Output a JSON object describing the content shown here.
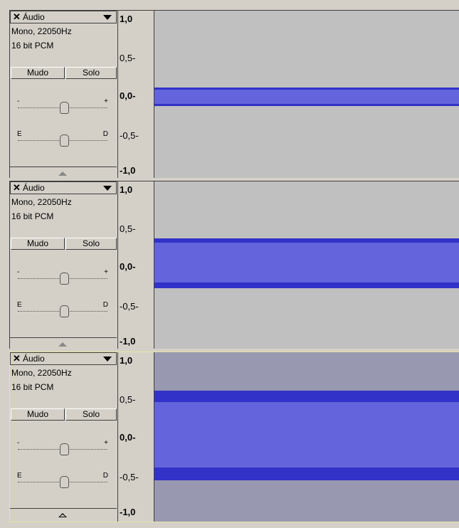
{
  "tracks": [
    {
      "name": "Áudio",
      "info1": "Mono, 22050Hz",
      "info2": "16 bit PCM",
      "mute": "Mudo",
      "solo": "Solo",
      "gain_minus": "-",
      "gain_plus": "+",
      "pan_left": "E",
      "pan_right": "D",
      "ruler": [
        "1,0",
        "0,5-",
        "0,0-",
        "-0,5-",
        "-1,0"
      ],
      "selected": false
    },
    {
      "name": "Áudio",
      "info1": "Mono, 22050Hz",
      "info2": "16 bit PCM",
      "mute": "Mudo",
      "solo": "Solo",
      "gain_minus": "-",
      "gain_plus": "+",
      "pan_left": "E",
      "pan_right": "D",
      "ruler": [
        "1,0",
        "0,5-",
        "0,0-",
        "-0,5-",
        "-1,0"
      ],
      "selected": false
    },
    {
      "name": "Áudio",
      "info1": "Mono, 22050Hz",
      "info2": "16 bit PCM",
      "mute": "Mudo",
      "solo": "Solo",
      "gain_minus": "-",
      "gain_plus": "+",
      "pan_left": "E",
      "pan_right": "D",
      "ruler": [
        "1,0",
        "0,5-",
        "0,0-",
        "-0,5-",
        "-1,0"
      ],
      "selected": true
    }
  ],
  "colors": {
    "waveform": "#6464dc",
    "waveform_edge": "#3232c8",
    "background": "#c0c0c0",
    "selected_background": "#9898b0",
    "selected_border": "#f0ec9c"
  }
}
